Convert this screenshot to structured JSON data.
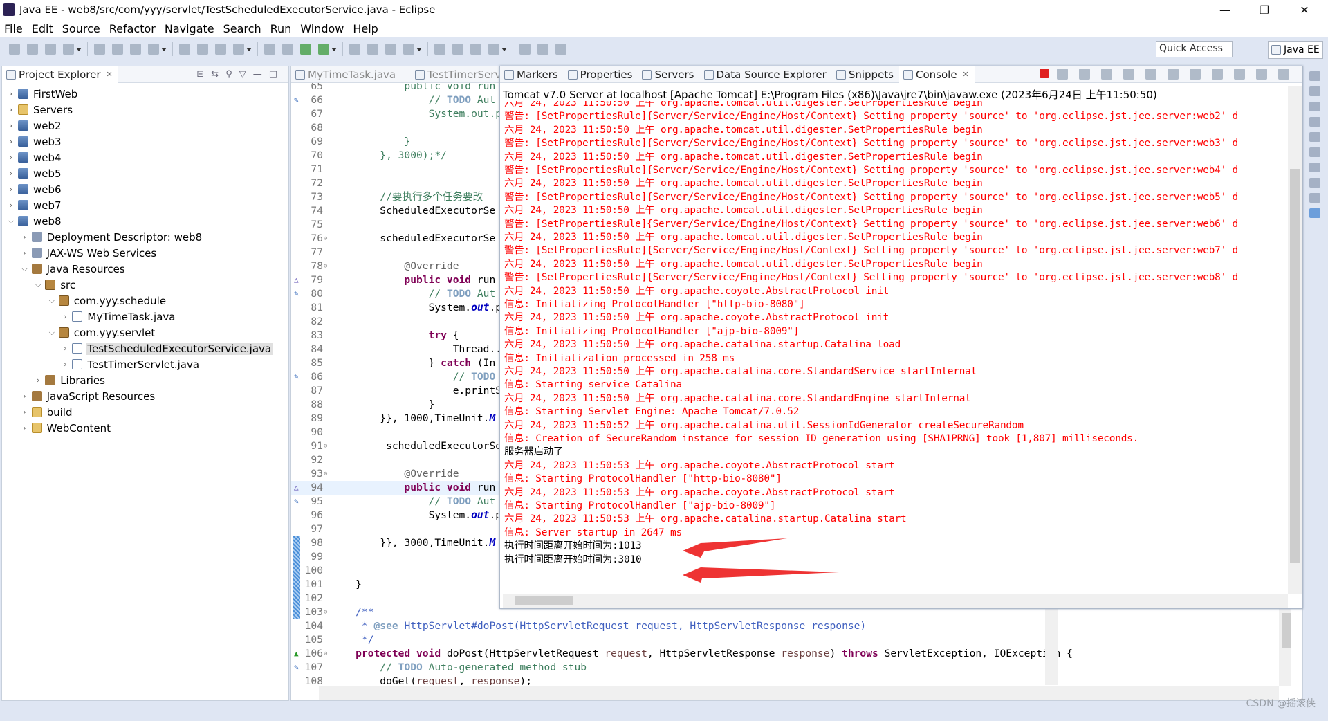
{
  "window": {
    "title": "Java EE - web8/src/com/yyy/servlet/TestScheduledExecutorService.java - Eclipse",
    "controls": [
      "—",
      "❐",
      "✕"
    ]
  },
  "menu": [
    "File",
    "Edit",
    "Source",
    "Refactor",
    "Navigate",
    "Search",
    "Run",
    "Window",
    "Help"
  ],
  "toolbar": {
    "quick_access_placeholder": "Quick Access",
    "perspective": "Java EE"
  },
  "explorer": {
    "title": "Project Explorer",
    "items": [
      {
        "label": "FirstWeb",
        "level": 0,
        "state": "closed",
        "icon": "project"
      },
      {
        "label": "Servers",
        "level": 0,
        "state": "closed",
        "icon": "folder"
      },
      {
        "label": "web2",
        "level": 0,
        "state": "closed",
        "icon": "project"
      },
      {
        "label": "web3",
        "level": 0,
        "state": "closed",
        "icon": "project"
      },
      {
        "label": "web4",
        "level": 0,
        "state": "closed",
        "icon": "project"
      },
      {
        "label": "web5",
        "level": 0,
        "state": "closed",
        "icon": "project"
      },
      {
        "label": "web6",
        "level": 0,
        "state": "closed",
        "icon": "project"
      },
      {
        "label": "web7",
        "level": 0,
        "state": "closed",
        "icon": "project"
      },
      {
        "label": "web8",
        "level": 0,
        "state": "open",
        "icon": "project"
      },
      {
        "label": "Deployment Descriptor: web8",
        "level": 1,
        "state": "closed",
        "icon": "dd"
      },
      {
        "label": "JAX-WS Web Services",
        "level": 1,
        "state": "closed",
        "icon": "dd"
      },
      {
        "label": "Java Resources",
        "level": 1,
        "state": "open",
        "icon": "lib"
      },
      {
        "label": "src",
        "level": 2,
        "state": "open",
        "icon": "package"
      },
      {
        "label": "com.yyy.schedule",
        "level": 3,
        "state": "open",
        "icon": "package"
      },
      {
        "label": "MyTimeTask.java",
        "level": 4,
        "state": "closed",
        "icon": "java"
      },
      {
        "label": "com.yyy.servlet",
        "level": 3,
        "state": "open",
        "icon": "package"
      },
      {
        "label": "TestScheduledExecutorService.java",
        "level": 4,
        "state": "closed",
        "icon": "java",
        "selected": true
      },
      {
        "label": "TestTimerServlet.java",
        "level": 4,
        "state": "closed",
        "icon": "java"
      },
      {
        "label": "Libraries",
        "level": 2,
        "state": "closed",
        "icon": "lib"
      },
      {
        "label": "JavaScript Resources",
        "level": 1,
        "state": "closed",
        "icon": "lib"
      },
      {
        "label": "build",
        "level": 1,
        "state": "closed",
        "icon": "folder"
      },
      {
        "label": "WebContent",
        "level": 1,
        "state": "closed",
        "icon": "folder"
      }
    ]
  },
  "editor": {
    "tabs": [
      "MyTimeTask.java",
      "TestTimerServ"
    ],
    "current_line": 94,
    "lines": [
      {
        "n": 65,
        "segs": [
          [
            "c",
            "            public void run"
          ]
        ]
      },
      {
        "n": 66,
        "mark": "task",
        "segs": [
          [
            "c",
            "                // "
          ],
          [
            "t",
            "TODO"
          ],
          [
            "c",
            " Aut"
          ]
        ]
      },
      {
        "n": 67,
        "segs": [
          [
            "c",
            "                System.out.p"
          ]
        ]
      },
      {
        "n": 68,
        "segs": []
      },
      {
        "n": 69,
        "segs": [
          [
            "c",
            "            }"
          ]
        ]
      },
      {
        "n": 70,
        "segs": [
          [
            "c",
            "        }, 3000);*/"
          ]
        ]
      },
      {
        "n": 71,
        "segs": []
      },
      {
        "n": 72,
        "segs": []
      },
      {
        "n": 73,
        "segs": [
          [
            "c",
            "        //要执行多个任务要改"
          ]
        ]
      },
      {
        "n": 74,
        "segs": [
          [
            "p",
            "        ScheduledExecutorSe"
          ]
        ]
      },
      {
        "n": 75,
        "segs": []
      },
      {
        "n": 76,
        "fold": true,
        "segs": [
          [
            "p",
            "        scheduledExecutorSe"
          ]
        ]
      },
      {
        "n": 77,
        "segs": []
      },
      {
        "n": 78,
        "fold": true,
        "segs": [
          [
            "a",
            "            @Override"
          ]
        ]
      },
      {
        "n": 79,
        "mark": "override",
        "segs": [
          [
            "k",
            "            public void"
          ],
          [
            "p",
            " run"
          ]
        ]
      },
      {
        "n": 80,
        "mark": "task",
        "segs": [
          [
            "c",
            "                // "
          ],
          [
            "t",
            "TODO"
          ],
          [
            "c",
            " Aut"
          ]
        ]
      },
      {
        "n": 81,
        "segs": [
          [
            "p",
            "                System."
          ],
          [
            "f",
            "out"
          ],
          [
            "p",
            ".p"
          ]
        ]
      },
      {
        "n": 82,
        "segs": []
      },
      {
        "n": 83,
        "segs": [
          [
            "k",
            "                try"
          ],
          [
            "p",
            " {"
          ]
        ]
      },
      {
        "n": 84,
        "segs": [
          [
            "p",
            "                    Thread.."
          ]
        ]
      },
      {
        "n": 85,
        "segs": [
          [
            "p",
            "                } "
          ],
          [
            "k",
            "catch"
          ],
          [
            "p",
            " (In"
          ]
        ]
      },
      {
        "n": 86,
        "mark": "task",
        "segs": [
          [
            "c",
            "                    // "
          ],
          [
            "t",
            "TODO"
          ]
        ]
      },
      {
        "n": 87,
        "segs": [
          [
            "p",
            "                    e.printS"
          ]
        ]
      },
      {
        "n": 88,
        "segs": [
          [
            "p",
            "                }"
          ]
        ]
      },
      {
        "n": 89,
        "segs": [
          [
            "p",
            "        }}, 1000,TimeUnit."
          ],
          [
            "f",
            "M"
          ]
        ]
      },
      {
        "n": 90,
        "segs": []
      },
      {
        "n": 91,
        "fold": true,
        "segs": [
          [
            "p",
            "         scheduledExecutorSe"
          ]
        ]
      },
      {
        "n": 92,
        "segs": []
      },
      {
        "n": 93,
        "fold": true,
        "segs": [
          [
            "a",
            "            @Override"
          ]
        ]
      },
      {
        "n": 94,
        "mark": "override",
        "segs": [
          [
            "k",
            "            public void"
          ],
          [
            "p",
            " run"
          ]
        ]
      },
      {
        "n": 95,
        "mark": "task",
        "segs": [
          [
            "c",
            "                // "
          ],
          [
            "t",
            "TODO"
          ],
          [
            "c",
            " Aut"
          ]
        ]
      },
      {
        "n": 96,
        "segs": [
          [
            "p",
            "                System."
          ],
          [
            "f",
            "out"
          ],
          [
            "p",
            ".p"
          ]
        ]
      },
      {
        "n": 97,
        "segs": []
      },
      {
        "n": 98,
        "segs": [
          [
            "p",
            "        }}, 3000,TimeUnit."
          ],
          [
            "f",
            "M"
          ]
        ]
      },
      {
        "n": 99,
        "segs": []
      },
      {
        "n": 100,
        "segs": []
      },
      {
        "n": 101,
        "segs": [
          [
            "p",
            "    }"
          ]
        ]
      },
      {
        "n": 102,
        "segs": []
      },
      {
        "n": 103,
        "fold": true,
        "segs": [
          [
            "j",
            "    /**"
          ]
        ]
      },
      {
        "n": 104,
        "segs": [
          [
            "j",
            "     * "
          ],
          [
            "jt",
            "@see"
          ],
          [
            "j",
            " HttpServlet#doPost(HttpServletRequest request, HttpServletResponse response)"
          ]
        ]
      },
      {
        "n": 105,
        "segs": [
          [
            "j",
            "     */"
          ]
        ]
      },
      {
        "n": 106,
        "fold": true,
        "mark": "override-green",
        "segs": [
          [
            "k",
            "    protected void"
          ],
          [
            "p",
            " doPost(HttpServletRequest "
          ],
          [
            "v",
            "request"
          ],
          [
            "p",
            ", HttpServletResponse "
          ],
          [
            "v",
            "response"
          ],
          [
            "p",
            ") "
          ],
          [
            "k",
            "throws"
          ],
          [
            "p",
            " ServletException, IOException {"
          ]
        ]
      },
      {
        "n": 107,
        "mark": "task",
        "segs": [
          [
            "c",
            "        // "
          ],
          [
            "t",
            "TODO"
          ],
          [
            "c",
            " Auto-generated method stub"
          ]
        ]
      },
      {
        "n": 108,
        "segs": [
          [
            "p",
            "        doGet("
          ],
          [
            "v",
            "request"
          ],
          [
            "p",
            ", "
          ],
          [
            "v",
            "response"
          ],
          [
            "p",
            ");"
          ]
        ]
      }
    ]
  },
  "console": {
    "tabs": [
      "Markers",
      "Properties",
      "Servers",
      "Data Source Explorer",
      "Snippets",
      "Console"
    ],
    "active_tab": "Console",
    "header": "Tomcat v7.0 Server at localhost [Apache Tomcat] E:\\Program Files (x86)\\Java\\jre7\\bin\\javaw.exe (2023年6月24日 上午11:50:50)",
    "colors": {
      "stderr": "#ff0000",
      "stdout": "#000000",
      "arrow": "#ee3333"
    },
    "lines": [
      {
        "t": "六月 24, 2023 11:50:50 上午 org.apache.tomcat.util.digester.SetPropertiesRule begin",
        "err": true
      },
      {
        "t": "警告: [SetPropertiesRule]{Server/Service/Engine/Host/Context} Setting property 'source' to 'org.eclipse.jst.jee.server:web2' d",
        "err": true
      },
      {
        "t": "六月 24, 2023 11:50:50 上午 org.apache.tomcat.util.digester.SetPropertiesRule begin",
        "err": true
      },
      {
        "t": "警告: [SetPropertiesRule]{Server/Service/Engine/Host/Context} Setting property 'source' to 'org.eclipse.jst.jee.server:web3' d",
        "err": true
      },
      {
        "t": "六月 24, 2023 11:50:50 上午 org.apache.tomcat.util.digester.SetPropertiesRule begin",
        "err": true
      },
      {
        "t": "警告: [SetPropertiesRule]{Server/Service/Engine/Host/Context} Setting property 'source' to 'org.eclipse.jst.jee.server:web4' d",
        "err": true
      },
      {
        "t": "六月 24, 2023 11:50:50 上午 org.apache.tomcat.util.digester.SetPropertiesRule begin",
        "err": true
      },
      {
        "t": "警告: [SetPropertiesRule]{Server/Service/Engine/Host/Context} Setting property 'source' to 'org.eclipse.jst.jee.server:web5' d",
        "err": true
      },
      {
        "t": "六月 24, 2023 11:50:50 上午 org.apache.tomcat.util.digester.SetPropertiesRule begin",
        "err": true
      },
      {
        "t": "警告: [SetPropertiesRule]{Server/Service/Engine/Host/Context} Setting property 'source' to 'org.eclipse.jst.jee.server:web6' d",
        "err": true
      },
      {
        "t": "六月 24, 2023 11:50:50 上午 org.apache.tomcat.util.digester.SetPropertiesRule begin",
        "err": true
      },
      {
        "t": "警告: [SetPropertiesRule]{Server/Service/Engine/Host/Context} Setting property 'source' to 'org.eclipse.jst.jee.server:web7' d",
        "err": true
      },
      {
        "t": "六月 24, 2023 11:50:50 上午 org.apache.tomcat.util.digester.SetPropertiesRule begin",
        "err": true
      },
      {
        "t": "警告: [SetPropertiesRule]{Server/Service/Engine/Host/Context} Setting property 'source' to 'org.eclipse.jst.jee.server:web8' d",
        "err": true
      },
      {
        "t": "六月 24, 2023 11:50:50 上午 org.apache.coyote.AbstractProtocol init",
        "err": true
      },
      {
        "t": "信息: Initializing ProtocolHandler [\"http-bio-8080\"]",
        "err": true
      },
      {
        "t": "六月 24, 2023 11:50:50 上午 org.apache.coyote.AbstractProtocol init",
        "err": true
      },
      {
        "t": "信息: Initializing ProtocolHandler [\"ajp-bio-8009\"]",
        "err": true
      },
      {
        "t": "六月 24, 2023 11:50:50 上午 org.apache.catalina.startup.Catalina load",
        "err": true
      },
      {
        "t": "信息: Initialization processed in 258 ms",
        "err": true
      },
      {
        "t": "六月 24, 2023 11:50:50 上午 org.apache.catalina.core.StandardService startInternal",
        "err": true
      },
      {
        "t": "信息: Starting service Catalina",
        "err": true
      },
      {
        "t": "六月 24, 2023 11:50:50 上午 org.apache.catalina.core.StandardEngine startInternal",
        "err": true
      },
      {
        "t": "信息: Starting Servlet Engine: Apache Tomcat/7.0.52",
        "err": true
      },
      {
        "t": "六月 24, 2023 11:50:52 上午 org.apache.catalina.util.SessionIdGenerator createSecureRandom",
        "err": true
      },
      {
        "t": "信息: Creation of SecureRandom instance for session ID generation using [SHA1PRNG] took [1,807] milliseconds.",
        "err": true
      },
      {
        "t": "服务器启动了",
        "err": false
      },
      {
        "t": "六月 24, 2023 11:50:53 上午 org.apache.coyote.AbstractProtocol start",
        "err": true
      },
      {
        "t": "信息: Starting ProtocolHandler [\"http-bio-8080\"]",
        "err": true
      },
      {
        "t": "六月 24, 2023 11:50:53 上午 org.apache.coyote.AbstractProtocol start",
        "err": true
      },
      {
        "t": "信息: Starting ProtocolHandler [\"ajp-bio-8009\"]",
        "err": true
      },
      {
        "t": "六月 24, 2023 11:50:53 上午 org.apache.catalina.startup.Catalina start",
        "err": true
      },
      {
        "t": "信息: Server startup in 2647 ms",
        "err": true
      },
      {
        "t": "执行时间距离开始时间为:1013",
        "err": false,
        "arrow": true
      },
      {
        "t": "执行时间距离开始时间为:3010",
        "err": false,
        "arrow": true
      }
    ]
  },
  "watermark": "CSDN @摇滚侠"
}
